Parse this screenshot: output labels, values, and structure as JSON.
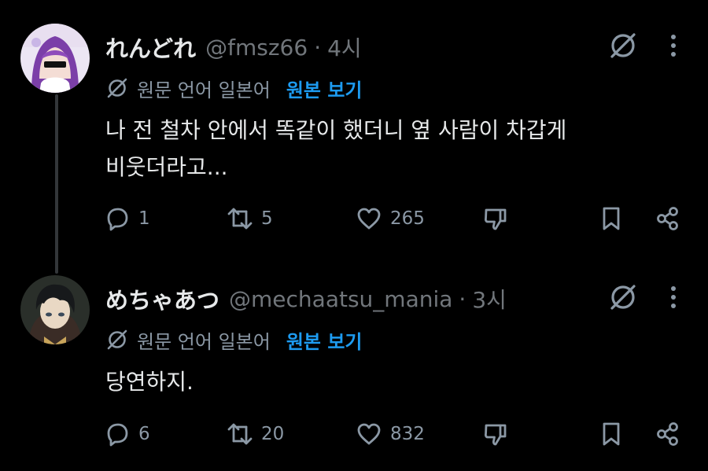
{
  "tweets": [
    {
      "name": "れんどれ",
      "handle": "@fmsz66",
      "separator": "·",
      "time": "4시",
      "translation_label": "원문 언어 일본어",
      "show_original": "원본 보기",
      "text_lines": [
        "나 전 철차 안에서 똑같이 했더니 옆 사람이 차갑게",
        "비웃더라고..."
      ],
      "replies": "1",
      "reposts": "5",
      "likes": "265",
      "dislikes": "",
      "avatar_icon": "avatar-anime-girl-purple-hair"
    },
    {
      "name": "めちゃあつ",
      "handle": "@mechaatsu_mania",
      "separator": "·",
      "time": "3시",
      "translation_label": "원문 언어 일본어",
      "show_original": "원본 보기",
      "text_lines": [
        "당연하지."
      ],
      "replies": "6",
      "reposts": "20",
      "likes": "832",
      "dislikes": "",
      "avatar_icon": "avatar-anime-boy-dark-hair"
    }
  ],
  "icons": {
    "grok": "grok-icon",
    "more": "more-icon",
    "reply": "reply-icon",
    "repost": "repost-icon",
    "like": "like-icon",
    "dislike": "dislike-icon",
    "bookmark": "bookmark-icon",
    "share": "share-icon",
    "translate": "translate-icon"
  },
  "colors": {
    "background": "#000000",
    "text": "#e7e9ea",
    "muted": "#71767b",
    "accent": "#1d9bf0"
  }
}
